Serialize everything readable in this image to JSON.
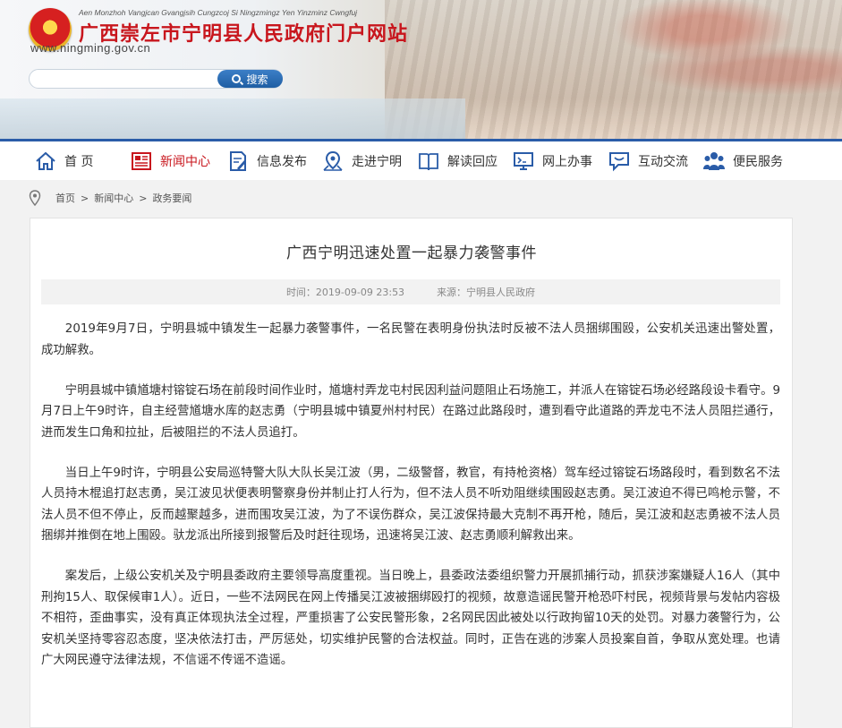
{
  "header": {
    "pinyin": "Aen Monzhoh Vangjcan Gvangjsih Cungzcoj Si Ningzmingz Yen Yinzminz Cwngfuj",
    "site_title": "广西崇左市宁明县人民政府门户网站",
    "site_url": "www.ningming.gov.cn",
    "search_placeholder": "",
    "search_button": "搜索"
  },
  "nav": {
    "items": [
      {
        "label": "首 页",
        "icon": "home-icon"
      },
      {
        "label": "新闻中心",
        "icon": "newspaper-icon"
      },
      {
        "label": "信息发布",
        "icon": "document-edit-icon"
      },
      {
        "label": "走进宁明",
        "icon": "map-pin-icon"
      },
      {
        "label": "解读回应",
        "icon": "book-icon"
      },
      {
        "label": "网上办事",
        "icon": "computer-icon"
      },
      {
        "label": "互动交流",
        "icon": "chat-icon"
      },
      {
        "label": "便民服务",
        "icon": "people-icon"
      }
    ],
    "active_index": 1,
    "accent_color": "#2a5ca8",
    "active_color": "#c8161d"
  },
  "breadcrumb": {
    "items": [
      "首页",
      "新闻中心",
      "政务要闻"
    ],
    "separator": ">"
  },
  "article": {
    "title": "广西宁明迅速处置一起暴力袭警事件",
    "time": "时间：2019-09-09 23:53",
    "source": "来源：宁明县人民政府",
    "paragraphs": [
      "2019年9月7日，宁明县城中镇发生一起暴力袭警事件，一名民警在表明身份执法时反被不法人员捆绑围殴，公安机关迅速出警处置，成功解救。",
      "宁明县城中镇馗塘村镕锭石场在前段时间作业时，馗塘村弄龙屯村民因利益问题阻止石场施工，并派人在镕锭石场必经路段设卡看守。9月7日上午9时许，自主经营馗塘水库的赵志勇（宁明县城中镇夏州村村民）在路过此路段时，遭到看守此道路的弄龙屯不法人员阻拦通行，进而发生口角和拉扯，后被阻拦的不法人员追打。",
      "当日上午9时许，宁明县公安局巡特警大队大队长吴江波（男，二级警督，教官，有持枪资格）驾车经过镕锭石场路段时，看到数名不法人员持木棍追打赵志勇，吴江波见状便表明警察身份并制止打人行为，但不法人员不听劝阻继续围殴赵志勇。吴江波迫不得已鸣枪示警，不法人员不但不停止，反而越聚越多，进而围攻吴江波，为了不误伤群众，吴江波保持最大克制不再开枪，随后，吴江波和赵志勇被不法人员捆绑并推倒在地上围殴。驮龙派出所接到报警后及时赶往现场，迅速将吴江波、赵志勇顺利解救出来。",
      "案发后，上级公安机关及宁明县委政府主要领导高度重视。当日晚上，县委政法委组织警力开展抓捕行动，抓获涉案嫌疑人16人（其中刑拘15人、取保候审1人）。近日，一些不法网民在网上传播吴江波被捆绑殴打的视频，故意造谣民警开枪恐吓村民，视频背景与发帖内容极不相符，歪曲事实，没有真正体现执法全过程，严重损害了公安民警形象，2名网民因此被处以行政拘留10天的处罚。对暴力袭警行为，公安机关坚持零容忍态度，坚决依法打击，严厉惩处，切实维护民警的合法权益。同时，正告在逃的涉案人员投案自首，争取从宽处理。也请广大网民遵守法律法规，不信谣不传谣不造谣。"
    ]
  }
}
